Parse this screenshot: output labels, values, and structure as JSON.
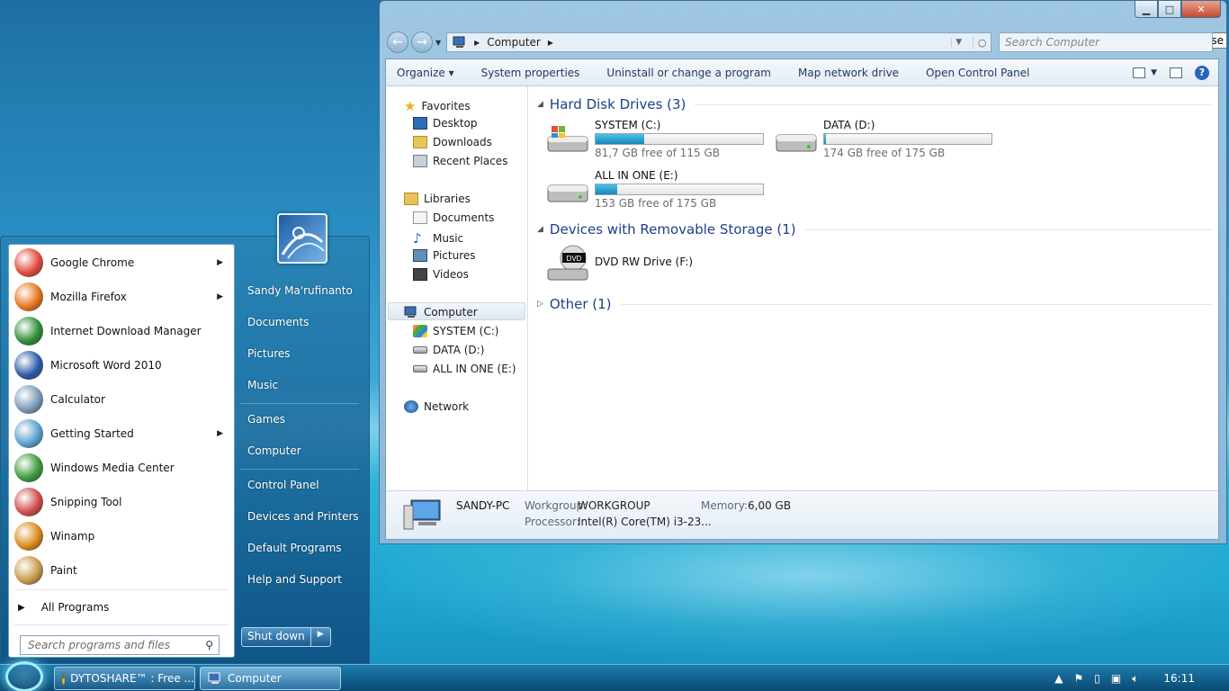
{
  "explorer": {
    "caption_buttons": {
      "minimize": "▁",
      "maximize": "□",
      "close": "✕"
    },
    "tooltip": "Close",
    "address": {
      "root_icon": "computer-icon",
      "path": "Computer"
    },
    "search_placeholder": "Search Computer",
    "commands": [
      "Organize ▾",
      "System properties",
      "Uninstall or change a program",
      "Map network drive",
      "Open Control Panel"
    ],
    "nav": {
      "favorites": {
        "label": "Favorites",
        "items": [
          "Desktop",
          "Downloads",
          "Recent Places"
        ]
      },
      "libraries": {
        "label": "Libraries",
        "items": [
          "Documents",
          "Music",
          "Pictures",
          "Videos"
        ]
      },
      "computer": {
        "label": "Computer",
        "items": [
          "SYSTEM (C:)",
          "DATA (D:)",
          "ALL IN ONE (E:)"
        ]
      },
      "network": {
        "label": "Network"
      }
    },
    "groups": {
      "hdd": "Hard Disk Drives (3)",
      "removable": "Devices with Removable Storage (1)",
      "other": "Other (1)"
    },
    "drives": [
      {
        "name": "SYSTEM (C:)",
        "free": "81,7 GB free of 115 GB",
        "used_fraction": 0.29
      },
      {
        "name": "DATA (D:)",
        "free": "174 GB free of 175 GB",
        "used_fraction": 0.006
      },
      {
        "name": "ALL IN ONE (E:)",
        "free": "153 GB free of 175 GB",
        "used_fraction": 0.126
      }
    ],
    "dvd": {
      "name": "DVD RW Drive (F:)",
      "badge": "DVD"
    },
    "details": {
      "pc_name": "SANDY-PC",
      "workgroup_label": "Workgroup:",
      "workgroup": "WORKGROUP",
      "memory_label": "Memory:",
      "memory": "6,00 GB",
      "processor_label": "Processor:",
      "processor": "Intel(R) Core(TM) i3-23..."
    }
  },
  "startmenu": {
    "programs": [
      {
        "label": "Google Chrome",
        "icon": "chrome-icon",
        "submenu": true,
        "color": "#e24a3b"
      },
      {
        "label": "Mozilla Firefox",
        "icon": "firefox-icon",
        "submenu": true,
        "color": "#e8741c"
      },
      {
        "label": "Internet Download Manager",
        "icon": "idm-icon",
        "submenu": false,
        "color": "#2f8f3a"
      },
      {
        "label": "Microsoft Word 2010",
        "icon": "word-icon",
        "submenu": false,
        "color": "#2b5aa8"
      },
      {
        "label": "Calculator",
        "icon": "calculator-icon",
        "submenu": false,
        "color": "#7a9ab8"
      },
      {
        "label": "Getting Started",
        "icon": "getting-started-icon",
        "submenu": true,
        "color": "#5aa0d0"
      },
      {
        "label": "Windows Media Center",
        "icon": "media-center-icon",
        "submenu": false,
        "color": "#3d9a3a"
      },
      {
        "label": "Snipping Tool",
        "icon": "snipping-tool-icon",
        "submenu": false,
        "color": "#d04c4c"
      },
      {
        "label": "Winamp",
        "icon": "winamp-icon",
        "submenu": false,
        "color": "#d98a1a"
      },
      {
        "label": "Paint",
        "icon": "paint-icon",
        "submenu": false,
        "color": "#c89a4a"
      }
    ],
    "all_programs": "All Programs",
    "search_placeholder": "Search programs and files",
    "right": {
      "user": "Sandy Ma'rufinanto",
      "documents": "Documents",
      "pictures": "Pictures",
      "music": "Music",
      "games": "Games",
      "computer": "Computer",
      "control_panel": "Control Panel",
      "devices": "Devices and Printers",
      "default_programs": "Default Programs",
      "help": "Help and Support"
    },
    "shutdown": "Shut down"
  },
  "taskbar": {
    "buttons": [
      {
        "label": "DYTOSHARE™ : Free ...",
        "icon": "chrome-icon"
      },
      {
        "label": "Computer",
        "icon": "computer-icon"
      }
    ],
    "clock": "16:11"
  }
}
